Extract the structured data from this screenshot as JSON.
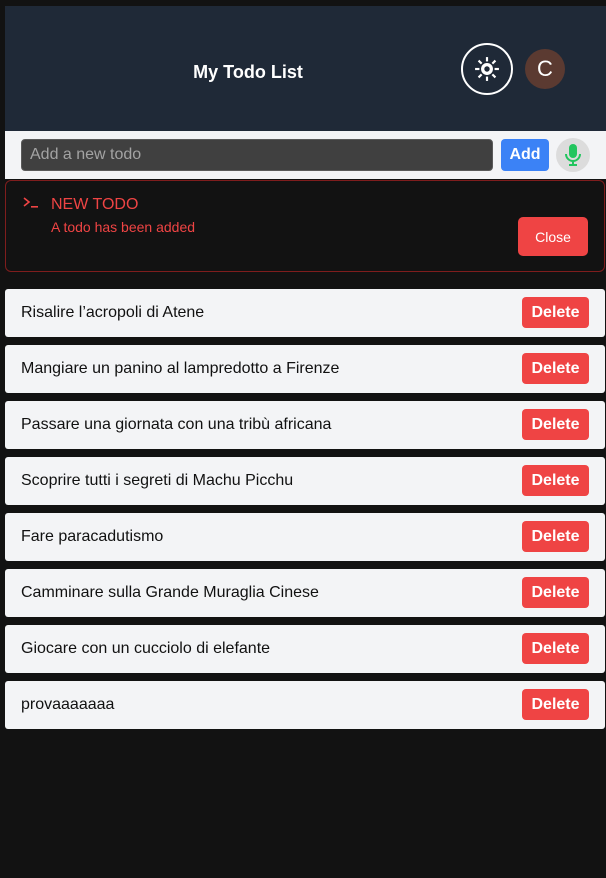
{
  "header": {
    "title": "My Todo List",
    "avatar_initial": "C",
    "theme_icon": "sun-gear-icon",
    "bg_color": "#1f2937"
  },
  "input_bar": {
    "placeholder": "Add a new todo",
    "value": "",
    "add_label": "Add",
    "mic_icon": "microphone-icon"
  },
  "alert": {
    "icon": "terminal-icon",
    "title": "NEW TODO",
    "message": "A todo has been added",
    "close_label": "Close",
    "color": "#ef4444"
  },
  "todos": [
    {
      "text": "Risalire l’acropoli di Atene",
      "delete_label": "Delete"
    },
    {
      "text": "Mangiare un panino al lampredotto a Firenze",
      "delete_label": "Delete"
    },
    {
      "text": "Passare una giornata con una tribù africana",
      "delete_label": "Delete"
    },
    {
      "text": "Scoprire tutti i segreti di Machu Picchu",
      "delete_label": "Delete"
    },
    {
      "text": "Fare paracadutismo",
      "delete_label": "Delete"
    },
    {
      "text": "Camminare sulla Grande Muraglia Cinese",
      "delete_label": "Delete"
    },
    {
      "text": "Giocare con un cucciolo di elefante",
      "delete_label": "Delete"
    },
    {
      "text": "provaaaaaaa",
      "delete_label": "Delete"
    }
  ]
}
